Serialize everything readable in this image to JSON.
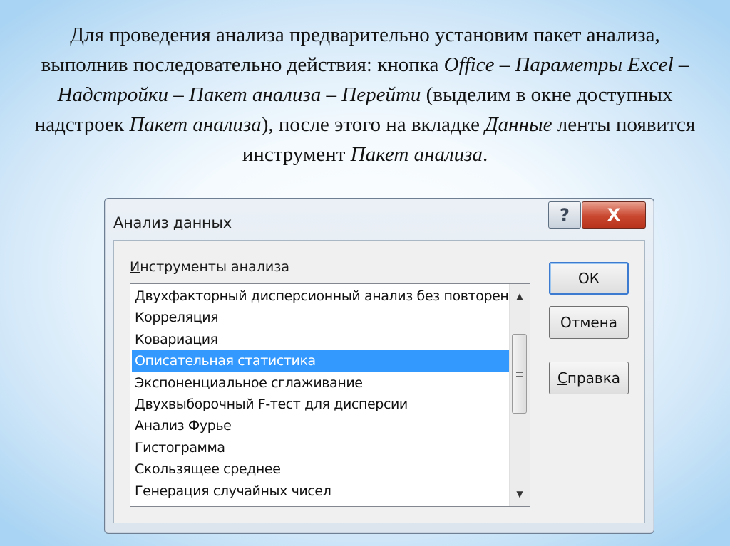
{
  "slide": {
    "paragraph": [
      {
        "text": "Для проведения анализа предварительно установим пакет анализа, выполнив последовательно действия: кнопка ",
        "italic": false
      },
      {
        "text": "Office – Параметры Excel – Надстройки – Пакет анализа – Перейти",
        "italic": true
      },
      {
        "text": " (выделим в окне доступных надстроек ",
        "italic": false
      },
      {
        "text": "Пакет анализа",
        "italic": true
      },
      {
        "text": "), после этого на вкладке ",
        "italic": false
      },
      {
        "text": "Данные",
        "italic": true
      },
      {
        "text": " ленты появится инструмент ",
        "italic": false
      },
      {
        "text": "Пакет анализа",
        "italic": true
      },
      {
        "text": ".",
        "italic": false
      }
    ]
  },
  "dialog": {
    "title": "Анализ данных",
    "help_glyph": "?",
    "close_glyph": "X",
    "list_label_accel": "И",
    "list_label_rest": "нструменты анализа",
    "items": [
      "Двухфакторный дисперсионный анализ без повторений",
      "Корреляция",
      "Ковариация",
      "Описательная статистика",
      "Экспоненциальное сглаживание",
      "Двухвыборочный F-тест для дисперсии",
      "Анализ Фурье",
      "Гистограмма",
      "Скользящее среднее",
      "Генерация случайных чисел"
    ],
    "selected_index": 3,
    "ok_label": "ОК",
    "cancel_label": "Отмена",
    "help_accel": "С",
    "help_rest": "правка",
    "colors": {
      "selection": "#3399ff",
      "close_button": "#c9472f"
    }
  }
}
